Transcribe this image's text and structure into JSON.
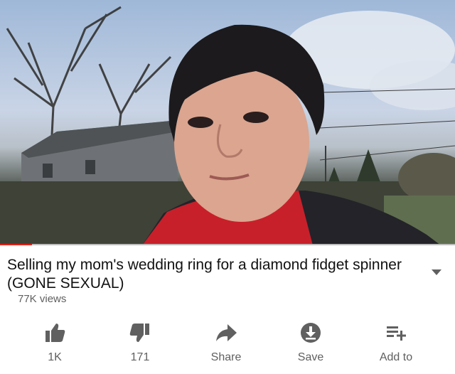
{
  "video": {
    "progress": 0.07,
    "progress_color": "#e62117"
  },
  "metadata": {
    "title": "Selling my mom's wedding ring for a diamond fidget spinner (GONE SEXUAL)",
    "views": "77K views"
  },
  "actions": [
    {
      "icon": "thumbs-up-icon",
      "label": "1K"
    },
    {
      "icon": "thumbs-down-icon",
      "label": "171"
    },
    {
      "icon": "share-icon",
      "label": "Share"
    },
    {
      "icon": "download-icon",
      "label": "Save"
    },
    {
      "icon": "playlist-add-icon",
      "label": "Add to"
    }
  ],
  "colors": {
    "icon": "#606060",
    "text": "#111111",
    "secondary_text": "#606060"
  }
}
